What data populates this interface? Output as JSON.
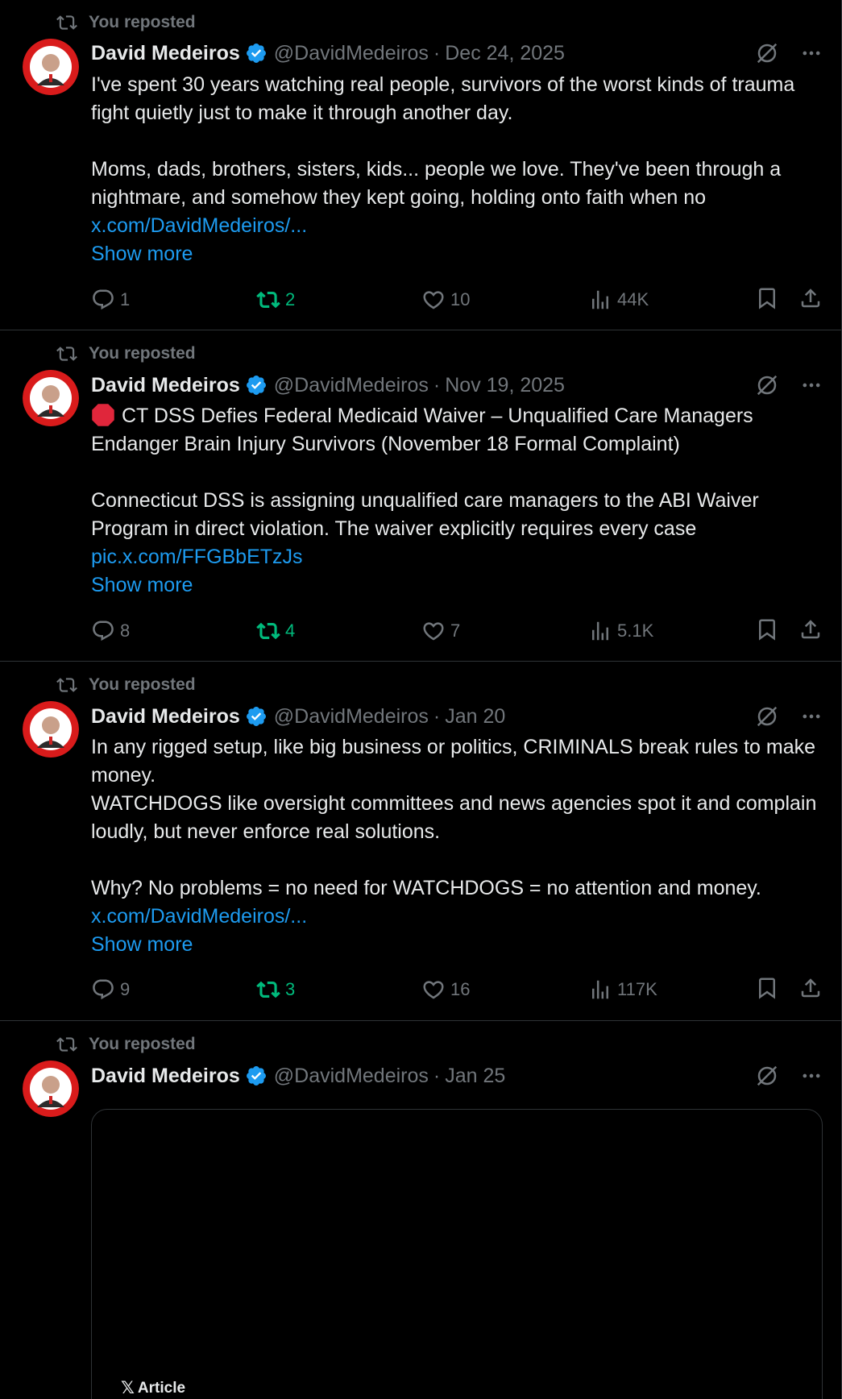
{
  "author": {
    "name": "David Medeiros",
    "handle": "@DavidMedeiros",
    "dot": "·"
  },
  "repost_label": "You reposted",
  "show_more": "Show more",
  "colors": {
    "accent": "#1d9bf0",
    "repost_green": "#00ba7c",
    "muted": "#71767b",
    "divider": "#2f3336"
  },
  "tweets": [
    {
      "date": "Dec 24, 2025",
      "text1": "I've spent 30 years watching real people, survivors of the worst kinds of trauma fight quietly just to make it through another day.",
      "text2": "Moms, dads, brothers, sisters, kids... people we love. They've been through a nightmare, and somehow they kept going, holding onto faith when no",
      "link": "x.com/DavidMedeiros/...",
      "replies": "1",
      "reposts": "2",
      "likes": "10",
      "views": "44K"
    },
    {
      "date": "Nov 19, 2025",
      "text1": "CT DSS Defies Federal Medicaid Waiver – Unqualified Care Managers Endanger Brain Injury Survivors (November 18 Formal Complaint)",
      "text2": "Connecticut DSS is assigning unqualified care managers to the ABI Waiver Program in direct violation. The waiver explicitly requires every case",
      "link": "pic.x.com/FFGBbETzJs",
      "replies": "8",
      "reposts": "4",
      "likes": "7",
      "views": "5.1K"
    },
    {
      "date": "Jan 20",
      "text1": "In any rigged setup, like big business or politics, CRIMINALS break rules to make money.",
      "text1b": "WATCHDOGS like oversight committees and news agencies spot it and complain loudly, but never enforce real solutions.",
      "text2": "Why? No problems = no need for WATCHDOGS = no attention and money.",
      "link": "x.com/DavidMedeiros/...",
      "replies": "9",
      "reposts": "3",
      "likes": "16",
      "views": "117K"
    },
    {
      "date": "Jan 25",
      "article_label": "Article"
    }
  ]
}
